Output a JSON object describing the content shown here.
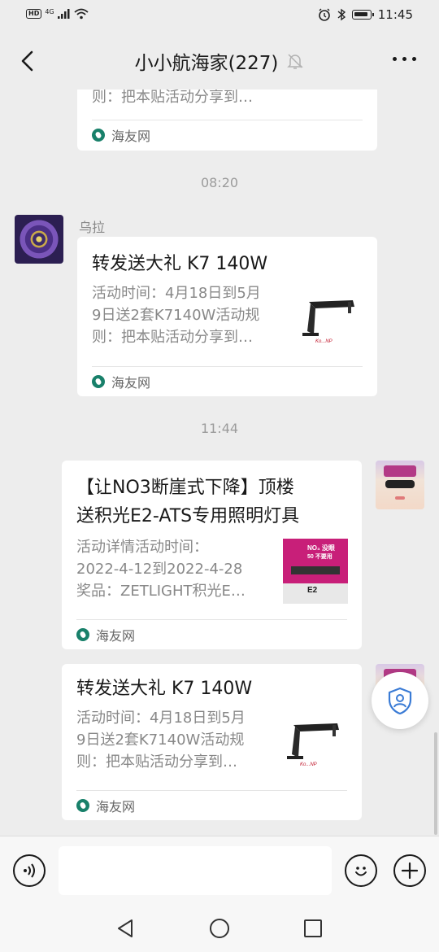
{
  "status_bar": {
    "network": "4G",
    "time": "11:45"
  },
  "header": {
    "title": "小小航海家(227)"
  },
  "messages": [
    {
      "desc": [
        "则：把本贴活动分享到…"
      ],
      "source": "海友网"
    },
    {
      "time": "08:20"
    },
    {
      "sender": "乌拉",
      "title": [
        "转发送大礼 K7 140W"
      ],
      "desc": [
        "活动时间：4月18日到5月",
        "9日送2套K7140W活动规",
        "则：把本贴活动分享到…"
      ],
      "source": "海友网"
    },
    {
      "time": "11:44"
    },
    {
      "title": [
        "【让NO3断崖式下降】顶楼",
        "送积光E2-ATS专用照明灯具"
      ],
      "desc": [
        "活动详情活动时间：",
        "2022-4-12到2022-4-28",
        "奖品：ZETLIGHT积光E…"
      ],
      "source": "海友网",
      "thumb_text": [
        "NO₃ 没眼",
        "50 不要用",
        "E2"
      ]
    },
    {
      "title": [
        "转发送大礼 K7 140W"
      ],
      "desc": [
        "活动时间：4月18日到5月",
        "9日送2套K7140W活动规",
        "则：把本贴活动分享到…"
      ],
      "source": "海友网"
    }
  ],
  "thumb_brand": "Ko...NP",
  "input": {
    "value": ""
  },
  "colors": {
    "background": "#ededed",
    "card": "#ffffff",
    "source_icon": "#18806a"
  },
  "icons": [
    "back-arrow-icon",
    "mute-bell-icon",
    "more-icon",
    "voice-icon",
    "emoji-icon",
    "add-icon",
    "shield-icon",
    "nav-back-icon",
    "nav-home-icon",
    "nav-recent-icon"
  ]
}
